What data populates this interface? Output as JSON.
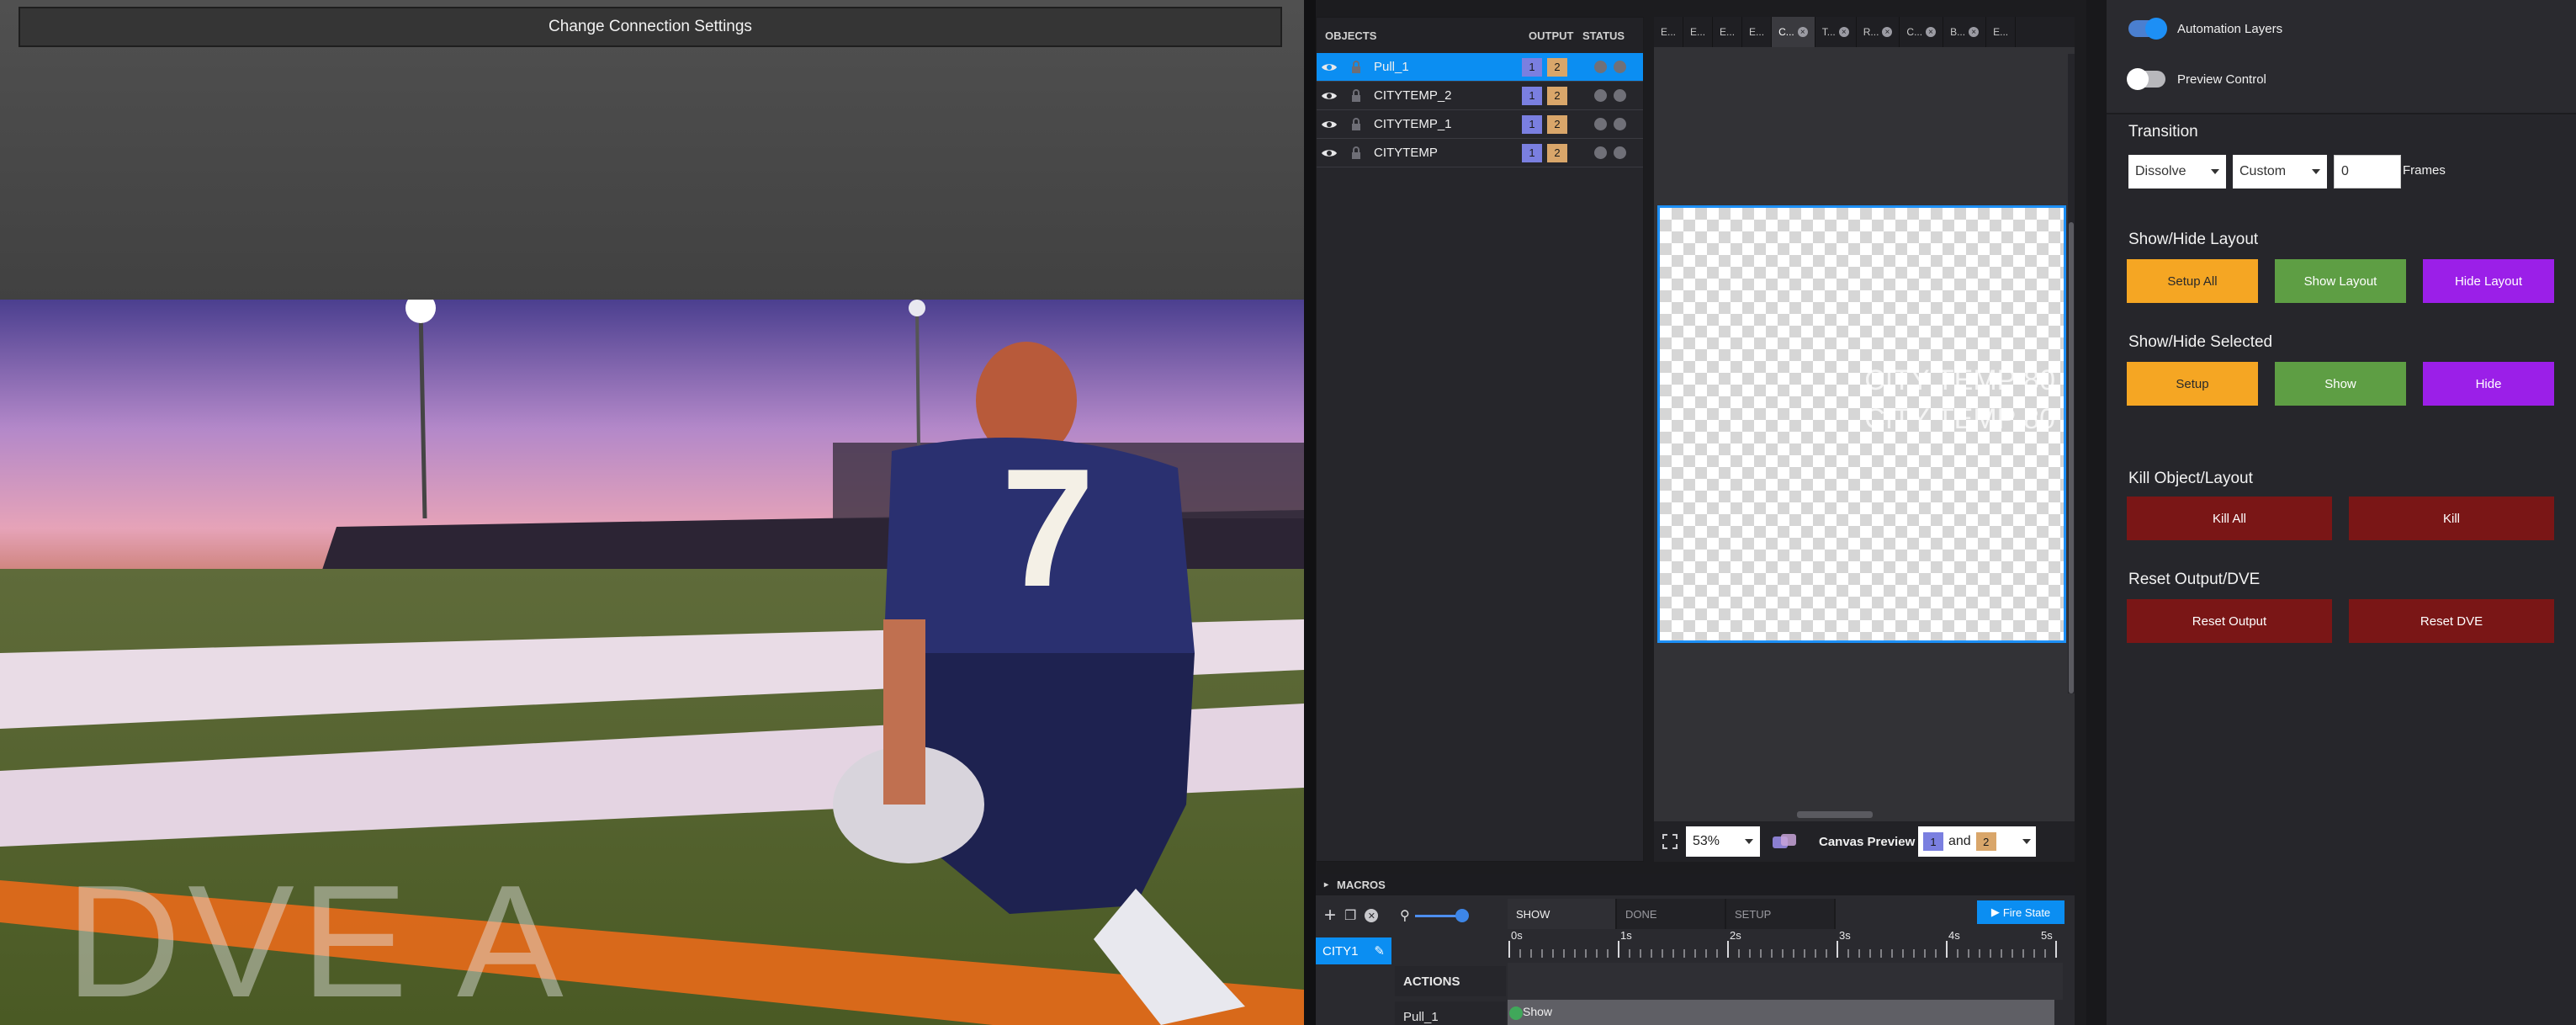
{
  "connection": {
    "button_label": "Change Connection Settings"
  },
  "preview": {
    "overlay_text": "DVE A",
    "jersey_number": "7"
  },
  "objects": {
    "headers": {
      "objects": "OBJECTS",
      "output": "OUTPUT",
      "status": "STATUS"
    },
    "rows": [
      {
        "name": "Pull_1",
        "out1": "1",
        "out2": "2",
        "selected": true
      },
      {
        "name": "CITYTEMP_2",
        "out1": "1",
        "out2": "2",
        "selected": false
      },
      {
        "name": "CITYTEMP_1",
        "out1": "1",
        "out2": "2",
        "selected": false
      },
      {
        "name": "CITYTEMP",
        "out1": "1",
        "out2": "2",
        "selected": false
      }
    ]
  },
  "canvas": {
    "tabs": [
      {
        "label": "E...",
        "closable": false,
        "active": false
      },
      {
        "label": "E...",
        "closable": false,
        "active": false
      },
      {
        "label": "E...",
        "closable": false,
        "active": false
      },
      {
        "label": "E...",
        "closable": false,
        "active": false
      },
      {
        "label": "C...",
        "closable": true,
        "active": true
      },
      {
        "label": "T...",
        "closable": true,
        "active": false
      },
      {
        "label": "R...",
        "closable": true,
        "active": false
      },
      {
        "label": "C...",
        "closable": true,
        "active": false
      },
      {
        "label": "B...",
        "closable": true,
        "active": false
      },
      {
        "label": "E...",
        "closable": false,
        "active": false
      }
    ],
    "ghost_line_1": "CITY TEMP 80",
    "ghost_line_2": "CITY TEMP 80",
    "zoom": "53%",
    "canvas_preview_label": "Canvas Preview",
    "cp_out1": "1",
    "cp_and": "and",
    "cp_out2": "2"
  },
  "macros": {
    "title": "MACROS",
    "macro_name": "CITY1",
    "states": [
      "SHOW",
      "DONE",
      "SETUP"
    ],
    "fire_label": "Fire State",
    "ticks": [
      "0s",
      "1s",
      "2s",
      "3s",
      "4s",
      "5s"
    ],
    "actions_header": "ACTIONS",
    "action_row": "Pull_1",
    "action_state": "Show"
  },
  "right": {
    "automation_layers": "Automation Layers",
    "preview_control": "Preview Control",
    "transition_title": "Transition",
    "transition_type": "Dissolve",
    "transition_mode": "Custom",
    "frames_value": "0",
    "frames_label": "Frames",
    "show_hide_layout_title": "Show/Hide Layout",
    "setup_all": "Setup All",
    "show_layout": "Show Layout",
    "hide_layout": "Hide Layout",
    "show_hide_selected_title": "Show/Hide Selected",
    "setup": "Setup",
    "show": "Show",
    "hide": "Hide",
    "kill_title": "Kill Object/Layout",
    "kill_all": "Kill All",
    "kill": "Kill",
    "reset_title": "Reset Output/DVE",
    "reset_output": "Reset Output",
    "reset_dve": "Reset DVE"
  },
  "colors": {
    "accent_blue": "#0b8ef2",
    "yellow": "#f5a623",
    "green": "#5e9e44",
    "purple": "#9b1fe8",
    "red": "#7a1616"
  }
}
